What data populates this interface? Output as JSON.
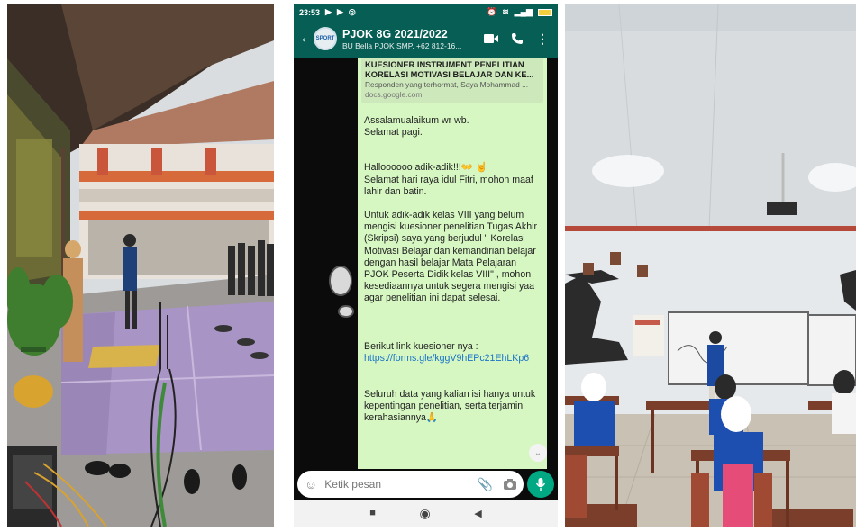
{
  "status_bar": {
    "time": "23:53",
    "left_icons": [
      "play-icon",
      "play-icon",
      "instagram-icon"
    ],
    "right_icons": [
      "alarm-icon",
      "headset-icon",
      "signal-icon",
      "wifi-icon",
      "battery-icon"
    ]
  },
  "chat_header": {
    "title": "PJOK 8G 2021/2022",
    "subtitle": "BU Bella PJOK SMP, +62 812-16...",
    "avatar_text": "SPORT"
  },
  "link_preview": {
    "title": "KUESIONER INSTRUMENT PENELITIAN KORELASI MOTIVASI BELAJAR DAN KE...",
    "description": "Responden yang terhormat, Saya Mohammad ...",
    "domain": "docs.google.com"
  },
  "message": {
    "greeting": "Assalamualaikum wr wb.\nSelamat pagi.",
    "hello": "Halloooooo adik-adik!!!",
    "hello_emoji": "👐 🤘",
    "eid": "Selamat hari raya idul Fitri, mohon maaf lahir dan batin.",
    "request": "Untuk adik-adik kelas VIII yang belum mengisi kuesioner penelitian Tugas Akhir (Skripsi) saya yang berjudul \" Korelasi Motivasi Belajar dan kemandirian belajar dengan hasil belajar Mata Pelajaran PJOK Peserta Didik kelas VIII\" , mohon kesediaannya untuk segera mengisi yaa agar penelitian ini dapat selesai.",
    "link_intro": "Berikut link kuesioner nya : ",
    "link": "https://forms.gle/kggV9hEPc21EhLKp6",
    "privacy": "Seluruh data yang kalian isi hanya untuk kepentingan penelitian, serta terjamin kerahasiannya",
    "privacy_emoji": "🙏"
  },
  "input": {
    "placeholder": "Ketik pesan"
  },
  "colors": {
    "whatsapp_header": "#075e54",
    "bubble": "#d6f7c2",
    "accent": "#00a884",
    "link": "#1a73c8"
  }
}
